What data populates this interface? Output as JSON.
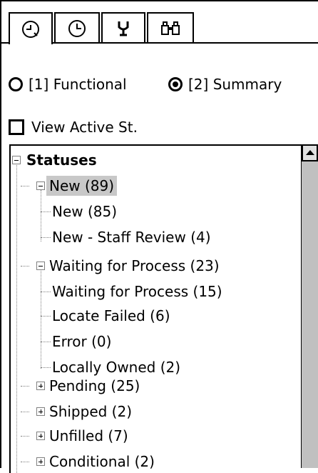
{
  "tabs": [
    {
      "icon": "clock-arrow-icon",
      "active": true
    },
    {
      "icon": "history-clock-icon",
      "active": false
    },
    {
      "icon": "trophy-icon",
      "active": false
    },
    {
      "icon": "binoculars-icon",
      "active": false
    }
  ],
  "view_options": {
    "functional_label": "[1] Functional",
    "summary_label": "[2] Summary",
    "selected": "summary",
    "active_st_label": "View Active St."
  },
  "tree": {
    "root": "Statuses",
    "nodes": [
      {
        "label": "New (89)",
        "level": 1,
        "expanded": true,
        "selected": true
      },
      {
        "label": "New (85)",
        "level": 2
      },
      {
        "label": "New - Staff Review (4)",
        "level": 2
      },
      {
        "label": "Waiting for Process (23)",
        "level": 1,
        "expanded": true
      },
      {
        "label": "Waiting for Process (15)",
        "level": 2
      },
      {
        "label": "Locate Failed (6)",
        "level": 2
      },
      {
        "label": "Error (0)",
        "level": 2
      },
      {
        "label": "Locally Owned (2)",
        "level": 2
      },
      {
        "label": "Pending (25)",
        "level": 1,
        "expanded": false
      },
      {
        "label": "Shipped (2)",
        "level": 1,
        "expanded": false
      },
      {
        "label": "Unfilled (7)",
        "level": 1,
        "expanded": false
      },
      {
        "label": "Conditional (2)",
        "level": 1,
        "expanded": false
      }
    ]
  }
}
